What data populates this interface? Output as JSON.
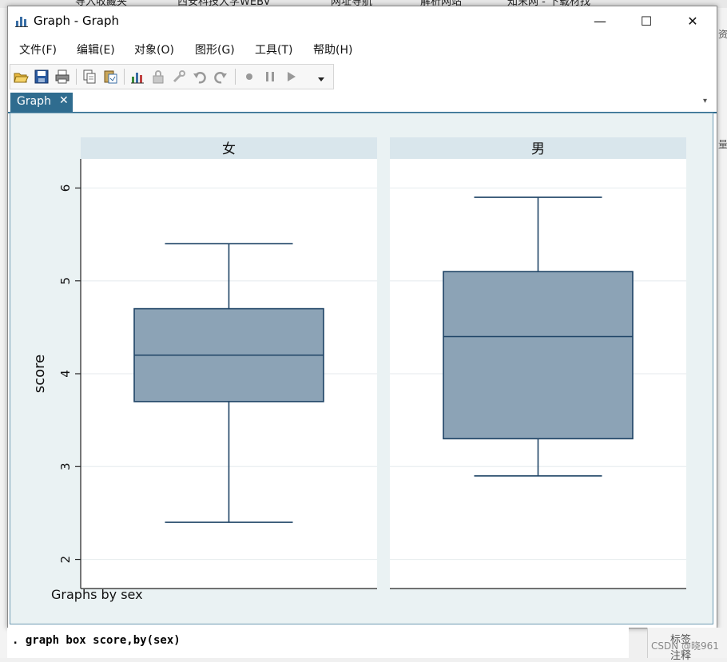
{
  "background": {
    "tabs": [
      "导入收藏夹",
      "西安科技大学WEBV",
      "网址导航",
      "解析网站",
      "知末网 - 下载材找"
    ],
    "right_labels": [
      "资",
      "量",
      "标签",
      "注释"
    ],
    "watermark": "CSDN @晓961"
  },
  "window": {
    "title": "Graph - Graph",
    "minimize": "—",
    "maximize": "☐",
    "close": "✕"
  },
  "menu": [
    "文件(F)",
    "编辑(E)",
    "对象(O)",
    "图形(G)",
    "工具(T)",
    "帮助(H)"
  ],
  "toolbar": {
    "buttons": [
      "open-icon",
      "save-icon",
      "print-icon",
      "copy-icon",
      "paste-icon",
      "graph-editor-icon",
      "lock-icon",
      "tool-icon",
      "undo-icon",
      "redo-icon",
      "record-icon",
      "pause-icon",
      "play-icon",
      "dropdown-icon"
    ]
  },
  "tab": {
    "label": "Graph",
    "close": "✕"
  },
  "colors": {
    "box_fill": "#8ca3b6",
    "box_stroke": "#1f4466",
    "plot_bg": "#eaf2f3",
    "strip_bg": "#d9e6ec",
    "accent": "#2f6c8f"
  },
  "command": ". graph box score,by(sex)",
  "chart_data": {
    "type": "box",
    "ylabel": "score",
    "yticks": [
      2,
      3,
      4,
      5,
      6
    ],
    "ylim": [
      1.85,
      6.15
    ],
    "note": "Graphs by sex",
    "grid": true,
    "panels": [
      {
        "label": "女",
        "min": 2.4,
        "q1": 3.7,
        "median": 4.2,
        "q3": 4.7,
        "max": 5.4
      },
      {
        "label": "男",
        "min": 2.9,
        "q1": 3.3,
        "median": 4.4,
        "q3": 5.1,
        "max": 5.9
      }
    ]
  }
}
